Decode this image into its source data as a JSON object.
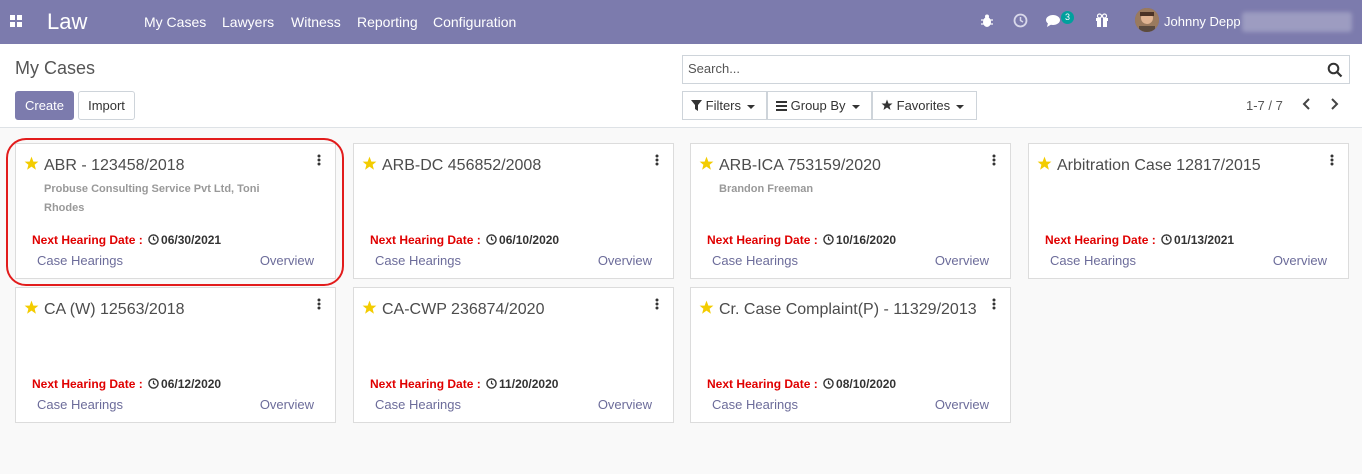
{
  "navbar": {
    "brand": "Law",
    "menu": [
      "My Cases",
      "Lawyers",
      "Witness",
      "Reporting",
      "Configuration"
    ],
    "messages_count": "3",
    "user_name": "Johnny Depp",
    "icons": [
      "apps-grid-icon",
      "bug-icon",
      "clock-icon",
      "chat-icon",
      "gift-icon"
    ]
  },
  "control_panel": {
    "title": "My Cases",
    "create_label": "Create",
    "import_label": "Import",
    "search_placeholder": "Search...",
    "filters_label": "Filters",
    "groupby_label": "Group By",
    "favorites_label": "Favorites",
    "pager": "1-7 / 7"
  },
  "cards": [
    {
      "title": "ABR - 123458/2018",
      "subtitle": "Probuse Consulting Service Pvt Ltd, Toni Rhodes",
      "hearing_label": "Next Hearing Date :",
      "date": "06/30/2021",
      "hearings_link": "Case Hearings",
      "overview_link": "Overview"
    },
    {
      "title": "ARB-DC 456852/2008",
      "subtitle": "",
      "hearing_label": "Next Hearing Date :",
      "date": "06/10/2020",
      "hearings_link": "Case Hearings",
      "overview_link": "Overview"
    },
    {
      "title": "ARB-ICA 753159/2020",
      "subtitle": "Brandon Freeman",
      "hearing_label": "Next Hearing Date :",
      "date": "10/16/2020",
      "hearings_link": "Case Hearings",
      "overview_link": "Overview"
    },
    {
      "title": "Arbitration Case 12817/2015",
      "subtitle": "",
      "hearing_label": "Next Hearing Date :",
      "date": "01/13/2021",
      "hearings_link": "Case Hearings",
      "overview_link": "Overview"
    },
    {
      "title": "CA (W) 12563/2018",
      "subtitle": "",
      "hearing_label": "Next Hearing Date :",
      "date": "06/12/2020",
      "hearings_link": "Case Hearings",
      "overview_link": "Overview"
    },
    {
      "title": "CA-CWP 236874/2020",
      "subtitle": "",
      "hearing_label": "Next Hearing Date :",
      "date": "11/20/2020",
      "hearings_link": "Case Hearings",
      "overview_link": "Overview"
    },
    {
      "title": "Cr. Case Complaint(P) - 11329/2013",
      "subtitle": "",
      "hearing_label": "Next Hearing Date :",
      "date": "08/10/2020",
      "hearings_link": "Case Hearings",
      "overview_link": "Overview"
    }
  ],
  "colors": {
    "brand": "#7c7bad",
    "hearing_label": "#e00000",
    "star": "#f3cc00",
    "highlight": "#e21c1c",
    "badge": "#00a09d"
  }
}
